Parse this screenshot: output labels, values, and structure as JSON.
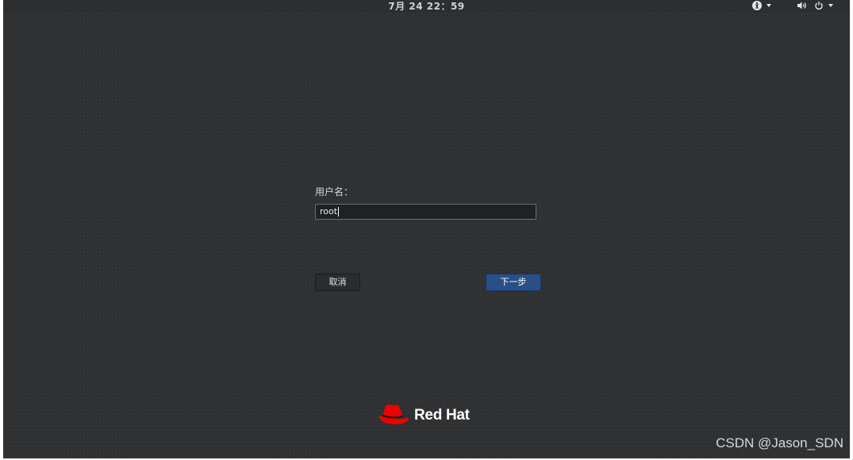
{
  "top_bar": {
    "clock": "7月 24 22：59",
    "icons": [
      "accessibility-icon",
      "volume-icon",
      "power-icon"
    ]
  },
  "login": {
    "username_label": "用户名：",
    "username_value": "root",
    "cancel_label": "取消",
    "next_label": "下一步"
  },
  "branding": {
    "logo_text": "Red Hat",
    "logo_color": "#ee0000"
  },
  "watermark": "CSDN @Jason_SDN",
  "colors": {
    "background": "#2f3133",
    "primary_button": "#2a4f84"
  }
}
